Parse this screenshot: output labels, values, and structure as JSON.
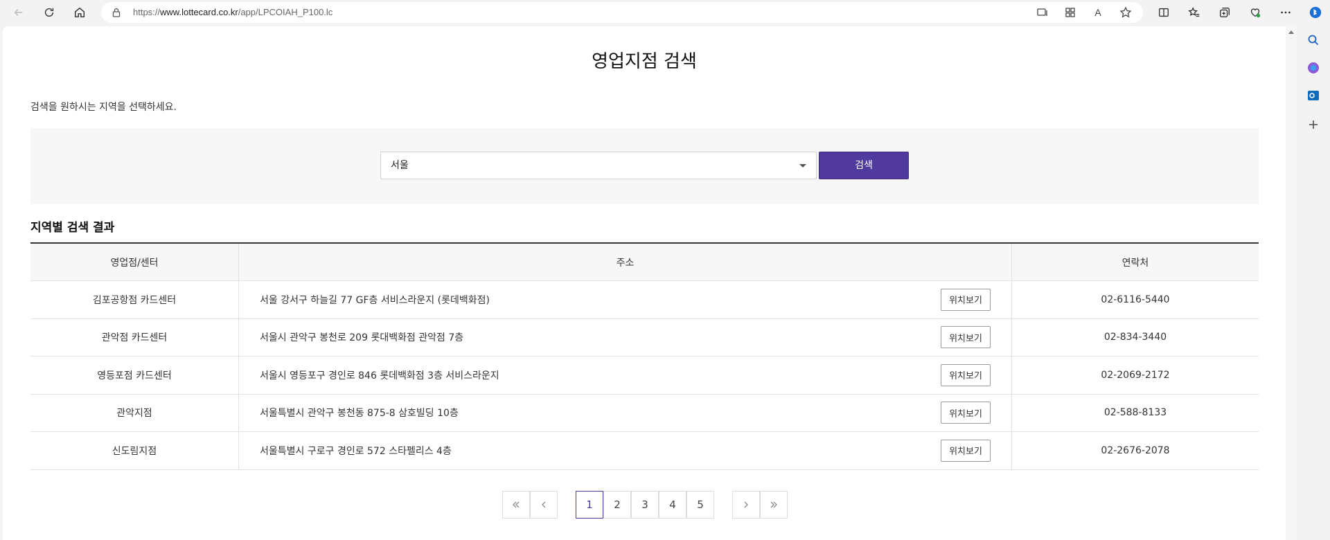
{
  "browser": {
    "url_prefix": "https://",
    "url_host": "www.lottecard.co.kr",
    "url_path": "/app/LPCOIAH_P100.lc",
    "icons": [
      "back-icon",
      "refresh-icon",
      "home-icon",
      "lock-icon",
      "read-mode-icon",
      "apps-icon",
      "read-aloud-icon",
      "favorite-star-icon",
      "split-screen-icon",
      "favorites-icon",
      "collections-icon",
      "health-icon",
      "more-icon",
      "bing-copilot-icon"
    ],
    "read_aloud_label": "A"
  },
  "sidebar": {
    "icons": [
      "search-icon",
      "copilot-icon",
      "outlook-icon",
      "add-icon"
    ]
  },
  "page": {
    "title": "영업지점 검색",
    "guide": "검색을 원하시는 지역을 선택하세요."
  },
  "search": {
    "region_selected": "서울",
    "button_label": "검색"
  },
  "results": {
    "title": "지역별 검색 결과",
    "columns": [
      "영업점/센터",
      "주소",
      "연락처"
    ],
    "location_button": "위치보기",
    "rows": [
      {
        "branch": "김포공항점 카드센터",
        "address": "서울 강서구 하늘길 77 GF층 서비스라운지 (롯데백화점)",
        "phone": "02-6116-5440"
      },
      {
        "branch": "관악점 카드센터",
        "address": "서울시 관악구 봉천로 209 롯대백화점 관악점 7층",
        "phone": "02-834-3440"
      },
      {
        "branch": "영등포점 카드센터",
        "address": "서울시 영등포구 경인로 846 롯데백화점 3층 서비스라운지",
        "phone": "02-2069-2172"
      },
      {
        "branch": "관악지점",
        "address": "서울특별시 관악구 봉천동 875-8 삼호빌딩 10층",
        "phone": "02-588-8133"
      },
      {
        "branch": "신도림지점",
        "address": "서울특별시 구로구 경인로 572 스타펠리스 4층",
        "phone": "02-2676-2078"
      }
    ]
  },
  "pagination": {
    "pages": [
      "1",
      "2",
      "3",
      "4",
      "5"
    ],
    "current": "1"
  },
  "colors": {
    "accent": "#503a9e",
    "header_bg": "#f7f7f7"
  }
}
